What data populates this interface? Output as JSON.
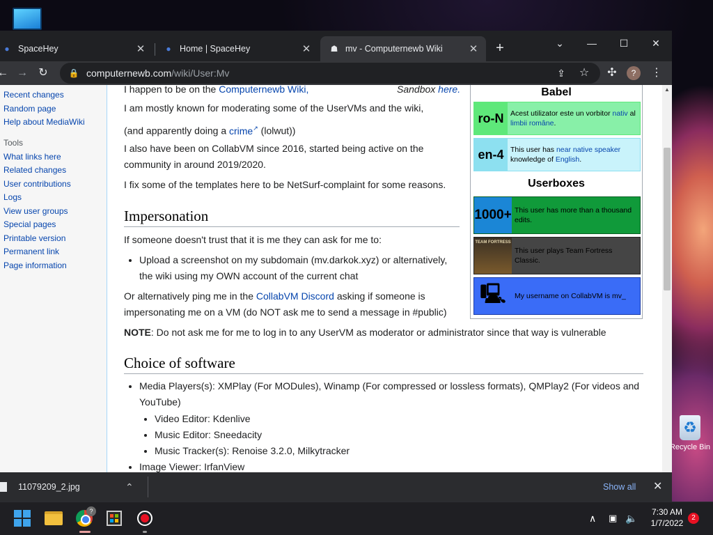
{
  "desktop": {
    "recycle_bin_label": "Recycle Bin"
  },
  "browser": {
    "tabs": [
      {
        "title": "SpaceHey",
        "close": "✕"
      },
      {
        "title": "Home | SpaceHey",
        "close": "✕"
      },
      {
        "title": "mv - Computernewb Wiki",
        "close": "✕"
      }
    ],
    "new_tab": "+",
    "window_controls": {
      "menu": "⌄",
      "minimize": "—",
      "maximize": "☐",
      "close": "✕"
    },
    "url_host": "computernewb.com",
    "url_path": "/wiki/User:Mv",
    "avatar_letter": "?"
  },
  "sidebar": {
    "top_links": [
      "Recent changes",
      "Random page",
      "Help about MediaWiki"
    ],
    "tools_heading": "Tools",
    "tools_links": [
      "What links here",
      "Related changes",
      "User contributions",
      "Logs",
      "View user groups",
      "Special pages",
      "Printable version",
      "Permanent link",
      "Page information"
    ]
  },
  "content": {
    "intro_line": "I happen to be on the",
    "intro_link": "Computernewb Wiki,",
    "sandbox_text": "Sandbox",
    "sandbox_link": "here.",
    "p1": "I am mostly known for moderating some of the UserVMs and the wiki,",
    "p2_pre": "(and apparently doing a",
    "p2_link": "crime",
    "p2_post": "(lolwut))",
    "p3_line1": "I also have been on CollabVM since 2016, started being active on the",
    "p3_line2": "community in around 2019/2020.",
    "p4": "I fix some of the templates here to be NetSurf-complaint for some reasons.",
    "h_impersonation": "Impersonation",
    "imp_p": "If someone doesn't trust that it is me they can ask for me to:",
    "imp_li_line1": "Upload a screenshot on my subdomain (mv.darkok.xyz) or alternatively,",
    "imp_li_line2": "the wiki using my OWN account of the current chat",
    "imp_alt_pre": "Or alternatively ping me in the",
    "imp_alt_link": "CollabVM Discord",
    "imp_alt_post": "asking if someone is",
    "imp_alt_line2": "impersonating me on a VM (do NOT ask me to send a message in #public)",
    "note_label": "NOTE",
    "note_text": ": Do not ask me for me to log in to any UserVM as moderator or administrator since that way is vulnerable",
    "h_software": "Choice of software",
    "sw_media_line1": "Media Players(s): XMPlay (For MODules), Winamp (For compressed or lossless formats), QMPlay2 (For videos and",
    "sw_media_line2": "YouTube)",
    "sw_sub": [
      "Video Editor: Kdenlive",
      "Music Editor: Sneedacity",
      "Music Tracker(s): Renoise 3.2.0, Milkytracker"
    ],
    "sw_image": "Image Viewer: IrfanView"
  },
  "panel": {
    "babel_title": "Babel",
    "ro": {
      "code": "ro-N",
      "text_pre": "Acest utilizator este un vorbitor",
      "link1": "nativ",
      "mid": "al",
      "link2": "limbii române",
      "end": "."
    },
    "en": {
      "code": "en-4",
      "text_pre": "This user has",
      "link1": "near native speaker",
      "mid": "knowledge of",
      "link2": "English",
      "end": "."
    },
    "userboxes_title": "Userboxes",
    "edits": {
      "code": "1000+",
      "text": "This user has more than a thousand edits."
    },
    "tf": {
      "code": "TEAM FORTRESS",
      "text": "This user plays Team Fortress Classic."
    },
    "cvm": {
      "text": "My username on CollabVM is mv_"
    }
  },
  "download_bar": {
    "file_name": "11079209_2.jpg",
    "show_all": "Show all"
  },
  "taskbar": {
    "time": "7:30 AM",
    "date": "1/7/2022",
    "notifications": "2",
    "chrome_badge": "?"
  },
  "colors": {
    "ro_bg": "#88f0a8",
    "ro_code_bg": "#5ee87a",
    "en_bg": "#c9f3fb",
    "en_code_bg": "#8de0f0",
    "edits_bg": "#109a3a",
    "edits_code_bg": "#1b86d6",
    "tf_bg": "#454545",
    "cvm_bg": "#3a6cf7"
  }
}
